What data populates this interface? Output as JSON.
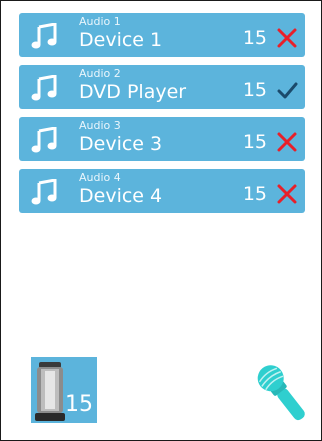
{
  "devices": [
    {
      "audio_label": "Audio 1",
      "name": "Device 1",
      "level": "15",
      "status_icon": "x-icon",
      "status_color": "#e8202a"
    },
    {
      "audio_label": "Audio 2",
      "name": "DVD Player",
      "level": "15",
      "status_icon": "check-icon",
      "status_color": "#1b4a6b"
    },
    {
      "audio_label": "Audio 3",
      "name": "Device 3",
      "level": "15",
      "status_icon": "x-icon",
      "status_color": "#e8202a"
    },
    {
      "audio_label": "Audio 4",
      "name": "Device 4",
      "level": "15",
      "status_icon": "x-icon",
      "status_color": "#e8202a"
    }
  ],
  "speaker": {
    "icon": "speaker-icon",
    "volume": "15"
  },
  "microphone": {
    "icon": "microphone-icon",
    "color": "#2fcfcf"
  },
  "colors": {
    "row_bg": "#5cb4dc",
    "text": "#ffffff"
  }
}
